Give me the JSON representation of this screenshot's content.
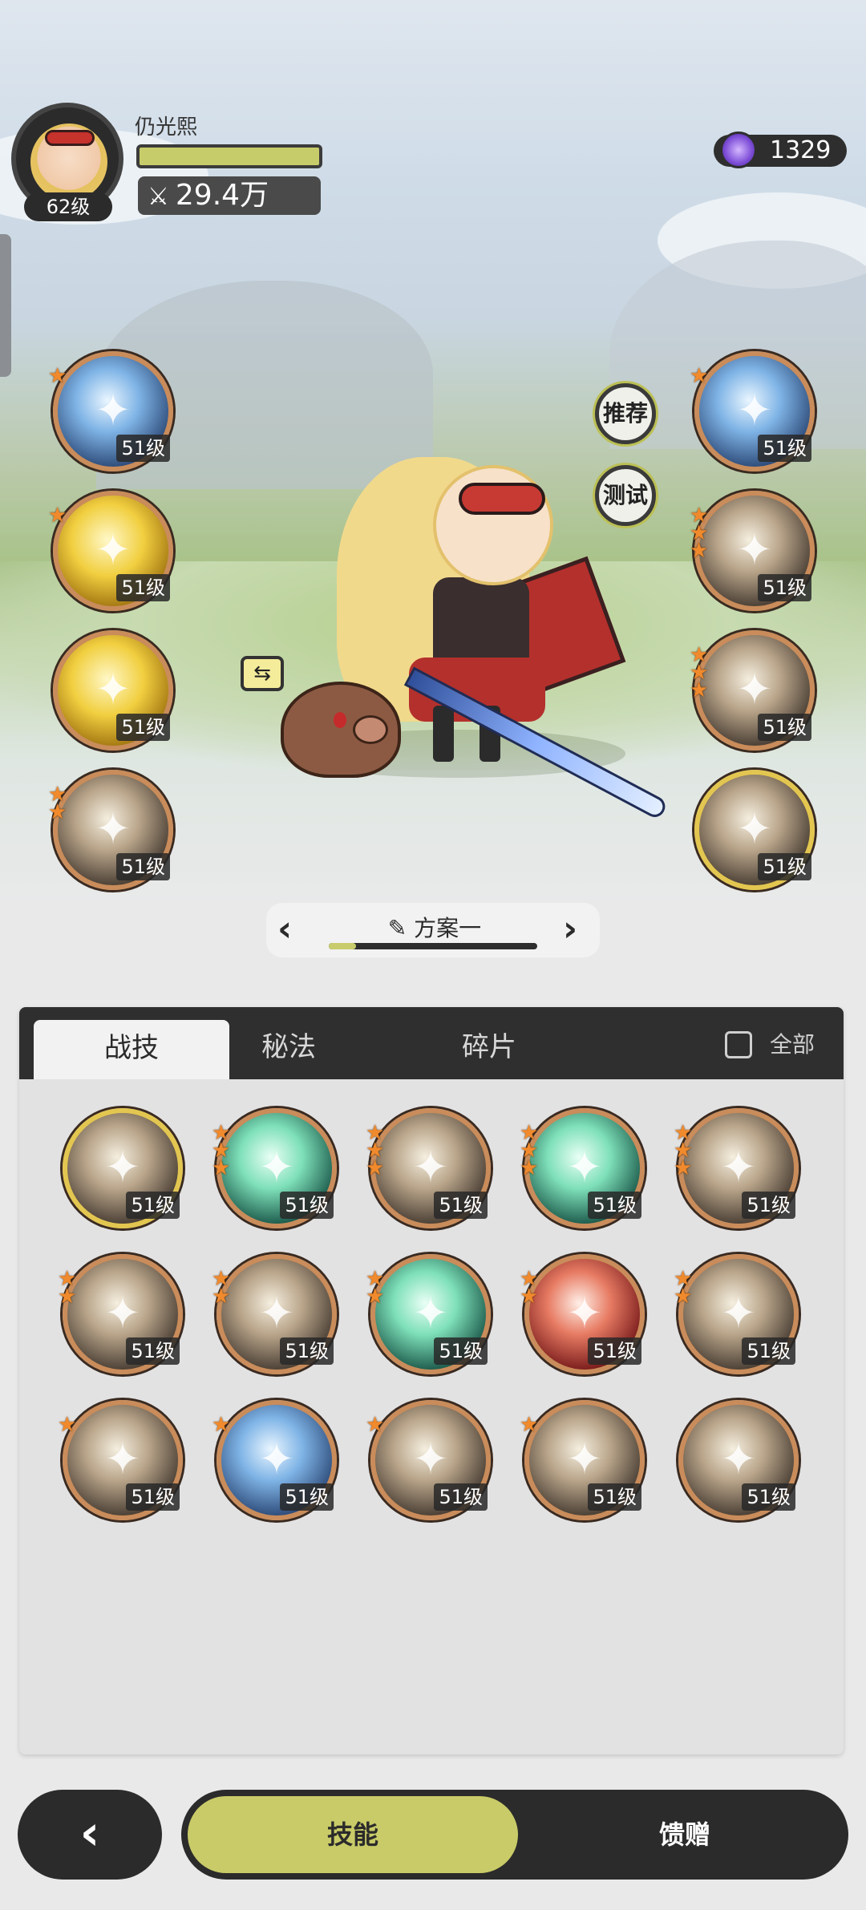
{
  "player": {
    "name": "仍光熙",
    "level": "62级",
    "power": "29.4万",
    "hp_fraction": 1.0
  },
  "currency": {
    "amount": "1329",
    "icon": "purple-gem-icon"
  },
  "buttons": {
    "recommend": "推荐",
    "test": "测试",
    "swap_icon": "swap-icon"
  },
  "equipped_left": [
    {
      "level": "51级",
      "stars": 1,
      "theme": "blue"
    },
    {
      "level": "51级",
      "stars": 1,
      "theme": "yellow"
    },
    {
      "level": "51级",
      "stars": 0,
      "theme": "yellow"
    },
    {
      "level": "51级",
      "stars": 2,
      "theme": "gray"
    }
  ],
  "equipped_right": [
    {
      "level": "51级",
      "stars": 1,
      "theme": "blue"
    },
    {
      "level": "51级",
      "stars": 3,
      "theme": "gray"
    },
    {
      "level": "51级",
      "stars": 3,
      "theme": "gray"
    },
    {
      "level": "51级",
      "stars": 0,
      "theme": "gray",
      "gold": true
    }
  ],
  "plan": {
    "name": "方案一",
    "prev": "‹",
    "next": "›",
    "progress": 0.13
  },
  "tabs": {
    "items": [
      "战技",
      "秘法",
      "碎片"
    ],
    "active": 0,
    "all_label": "全部"
  },
  "skill_grid": [
    {
      "level": "51级",
      "stars": 0,
      "theme": "gray",
      "gold": true
    },
    {
      "level": "51级",
      "stars": 3,
      "theme": "teal"
    },
    {
      "level": "51级",
      "stars": 3,
      "theme": "gray"
    },
    {
      "level": "51级",
      "stars": 3,
      "theme": "teal"
    },
    {
      "level": "51级",
      "stars": 3,
      "theme": "gray"
    },
    {
      "level": "51级",
      "stars": 2,
      "theme": "gray"
    },
    {
      "level": "51级",
      "stars": 2,
      "theme": "gray"
    },
    {
      "level": "51级",
      "stars": 2,
      "theme": "teal"
    },
    {
      "level": "51级",
      "stars": 2,
      "theme": "red"
    },
    {
      "level": "51级",
      "stars": 2,
      "theme": "gray"
    },
    {
      "level": "51级",
      "stars": 1,
      "theme": "gray"
    },
    {
      "level": "51级",
      "stars": 1,
      "theme": "blue"
    },
    {
      "level": "51级",
      "stars": 1,
      "theme": "gray"
    },
    {
      "level": "51级",
      "stars": 1,
      "theme": "gray"
    },
    {
      "level": "51级",
      "stars": 0,
      "theme": "gray"
    }
  ],
  "bottom": {
    "back": "‹",
    "skills": "技能",
    "gift": "馈赠"
  }
}
